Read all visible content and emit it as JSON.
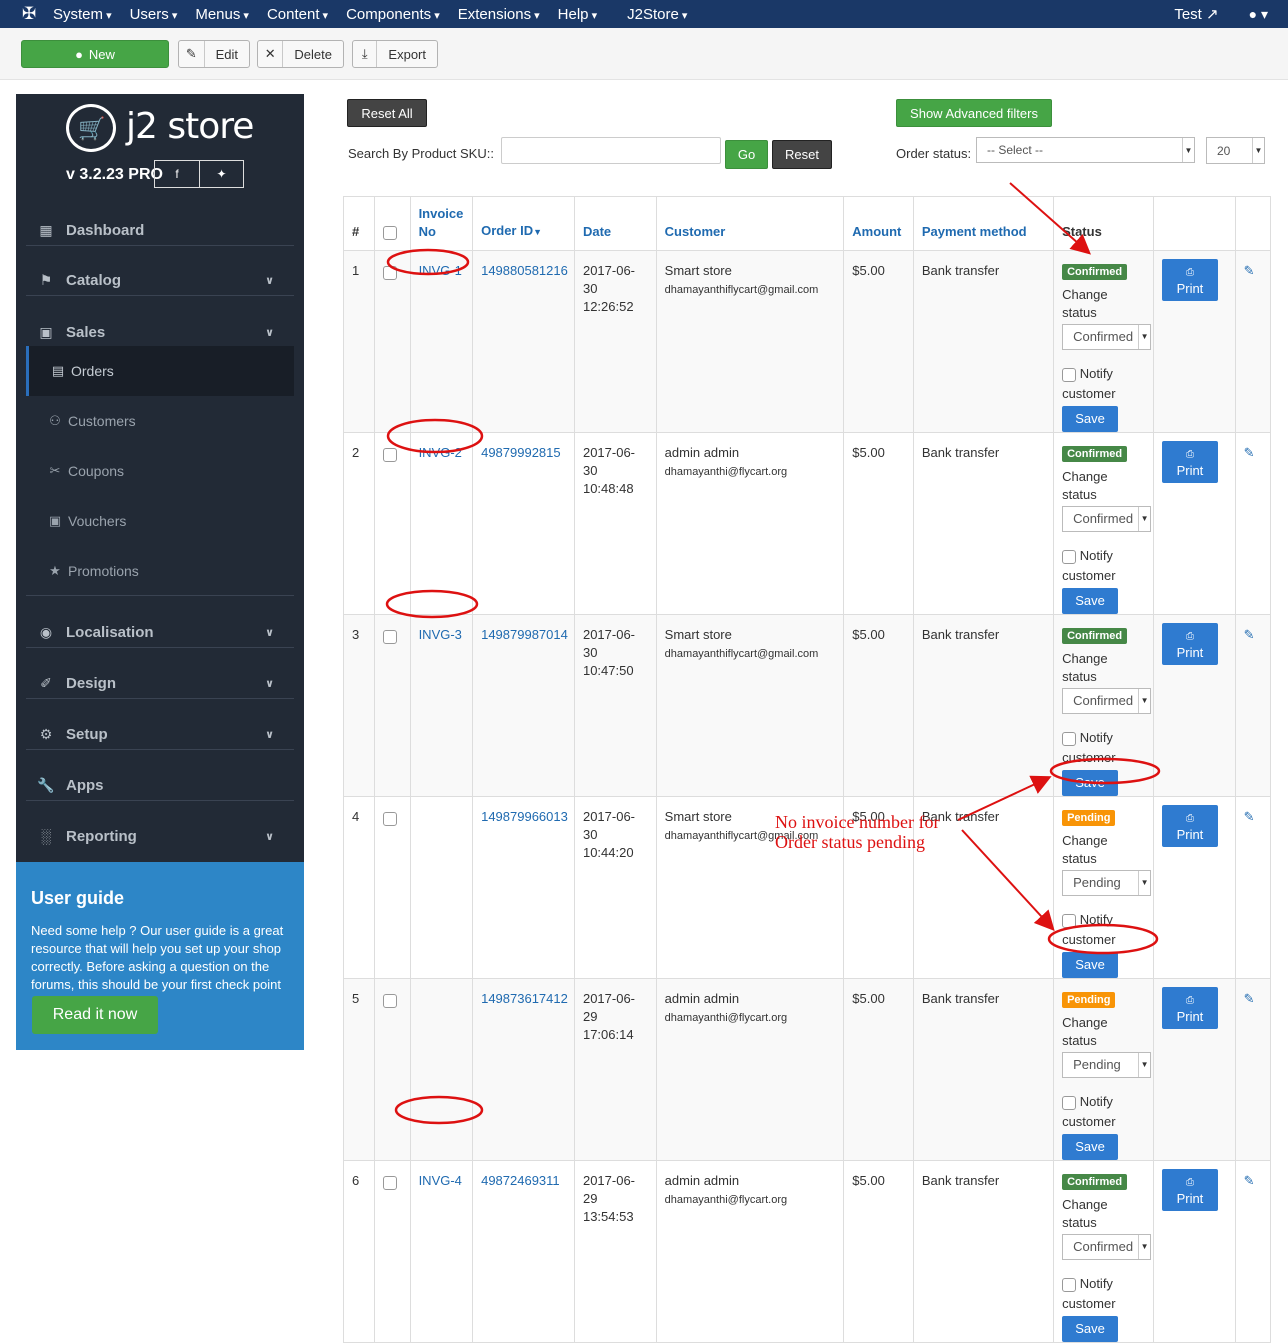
{
  "topnav": {
    "menus": [
      "System",
      "Users",
      "Menus",
      "Content",
      "Components",
      "Extensions",
      "Help",
      "J2Store"
    ],
    "site_link": "Test",
    "icons": {
      "logo": "joomla-icon",
      "external": "external-link-icon",
      "user": "user-icon"
    }
  },
  "toolbar": {
    "new_label": "New",
    "edit_label": "Edit",
    "delete_label": "Delete",
    "export_label": "Export"
  },
  "sidebar": {
    "brand": "j2 store",
    "version": "v 3.2.23 PRO",
    "items": [
      {
        "label": "Dashboard"
      },
      {
        "label": "Catalog"
      },
      {
        "label": "Sales"
      },
      {
        "label": "Localisation"
      },
      {
        "label": "Design"
      },
      {
        "label": "Setup"
      },
      {
        "label": "Apps"
      },
      {
        "label": "Reporting"
      }
    ],
    "sales_sub": [
      {
        "label": "Orders"
      },
      {
        "label": "Customers"
      },
      {
        "label": "Coupons"
      },
      {
        "label": "Vouchers"
      },
      {
        "label": "Promotions"
      }
    ]
  },
  "user_guide": {
    "title": "User guide",
    "text": "Need some help ? Our user guide is a great resource that will help you set up your shop correctly. Before asking a question on the forums, this should be your first check point",
    "button": "Read it now"
  },
  "filters": {
    "reset_all": "Reset All",
    "advanced": "Show Advanced filters",
    "sku_label": "Search By Product SKU::",
    "go": "Go",
    "reset": "Reset",
    "status_label": "Order status:",
    "status_select": "-- Select --",
    "limit": "20"
  },
  "table": {
    "headers": {
      "hash": "#",
      "invoice_line1": "Invoice",
      "invoice_line2": "No",
      "order_id": "Order ID",
      "date": "Date",
      "customer": "Customer",
      "amount": "Amount",
      "payment": "Payment method",
      "status": "Status"
    },
    "labels": {
      "change_status": "Change status",
      "notify_line1": "Notify",
      "notify_line2": "customer",
      "save": "Save",
      "print": "Print"
    },
    "rows": [
      {
        "num": "1",
        "invoice": "INVG-1",
        "order_id": "149880581216",
        "date": "2017-06-30",
        "time": "12:26:52",
        "customer": "Smart store",
        "email": "dhamayanthiflycart@gmail.com",
        "amount": "$5.00",
        "payment": "Bank transfer",
        "status": "Confirmed",
        "select": "Confirmed"
      },
      {
        "num": "2",
        "invoice": "INVG-2",
        "order_id": "49879992815",
        "date": "2017-06-30",
        "time": "10:48:48",
        "customer": "admin admin",
        "email": "dhamayanthi@flycart.org",
        "amount": "$5.00",
        "payment": "Bank transfer",
        "status": "Confirmed",
        "select": "Confirmed"
      },
      {
        "num": "3",
        "invoice": "INVG-3",
        "order_id": "149879987014",
        "date": "2017-06-30",
        "time": "10:47:50",
        "customer": "Smart store",
        "email": "dhamayanthiflycart@gmail.com",
        "amount": "$5.00",
        "payment": "Bank transfer",
        "status": "Confirmed",
        "select": "Confirmed"
      },
      {
        "num": "4",
        "invoice": "",
        "order_id": "149879966013",
        "date": "2017-06-30",
        "time": "10:44:20",
        "customer": "Smart store",
        "email": "dhamayanthiflycart@gmail.com",
        "amount": "$5.00",
        "payment": "Bank transfer",
        "status": "Pending",
        "select": "Pending"
      },
      {
        "num": "5",
        "invoice": "",
        "order_id": "149873617412",
        "date": "2017-06-29",
        "time": "17:06:14",
        "customer": "admin admin",
        "email": "dhamayanthi@flycart.org",
        "amount": "$5.00",
        "payment": "Bank transfer",
        "status": "Pending",
        "select": "Pending"
      },
      {
        "num": "6",
        "invoice": "INVG-4",
        "order_id": "49872469311",
        "date": "2017-06-29",
        "time": "13:54:53",
        "customer": "admin admin",
        "email": "dhamayanthi@flycart.org",
        "amount": "$5.00",
        "payment": "Bank transfer",
        "status": "Confirmed",
        "select": "Confirmed"
      }
    ]
  },
  "annotation": {
    "line1": "No invoice number for",
    "line2": "Order status pending",
    "color": "#dd1111"
  }
}
